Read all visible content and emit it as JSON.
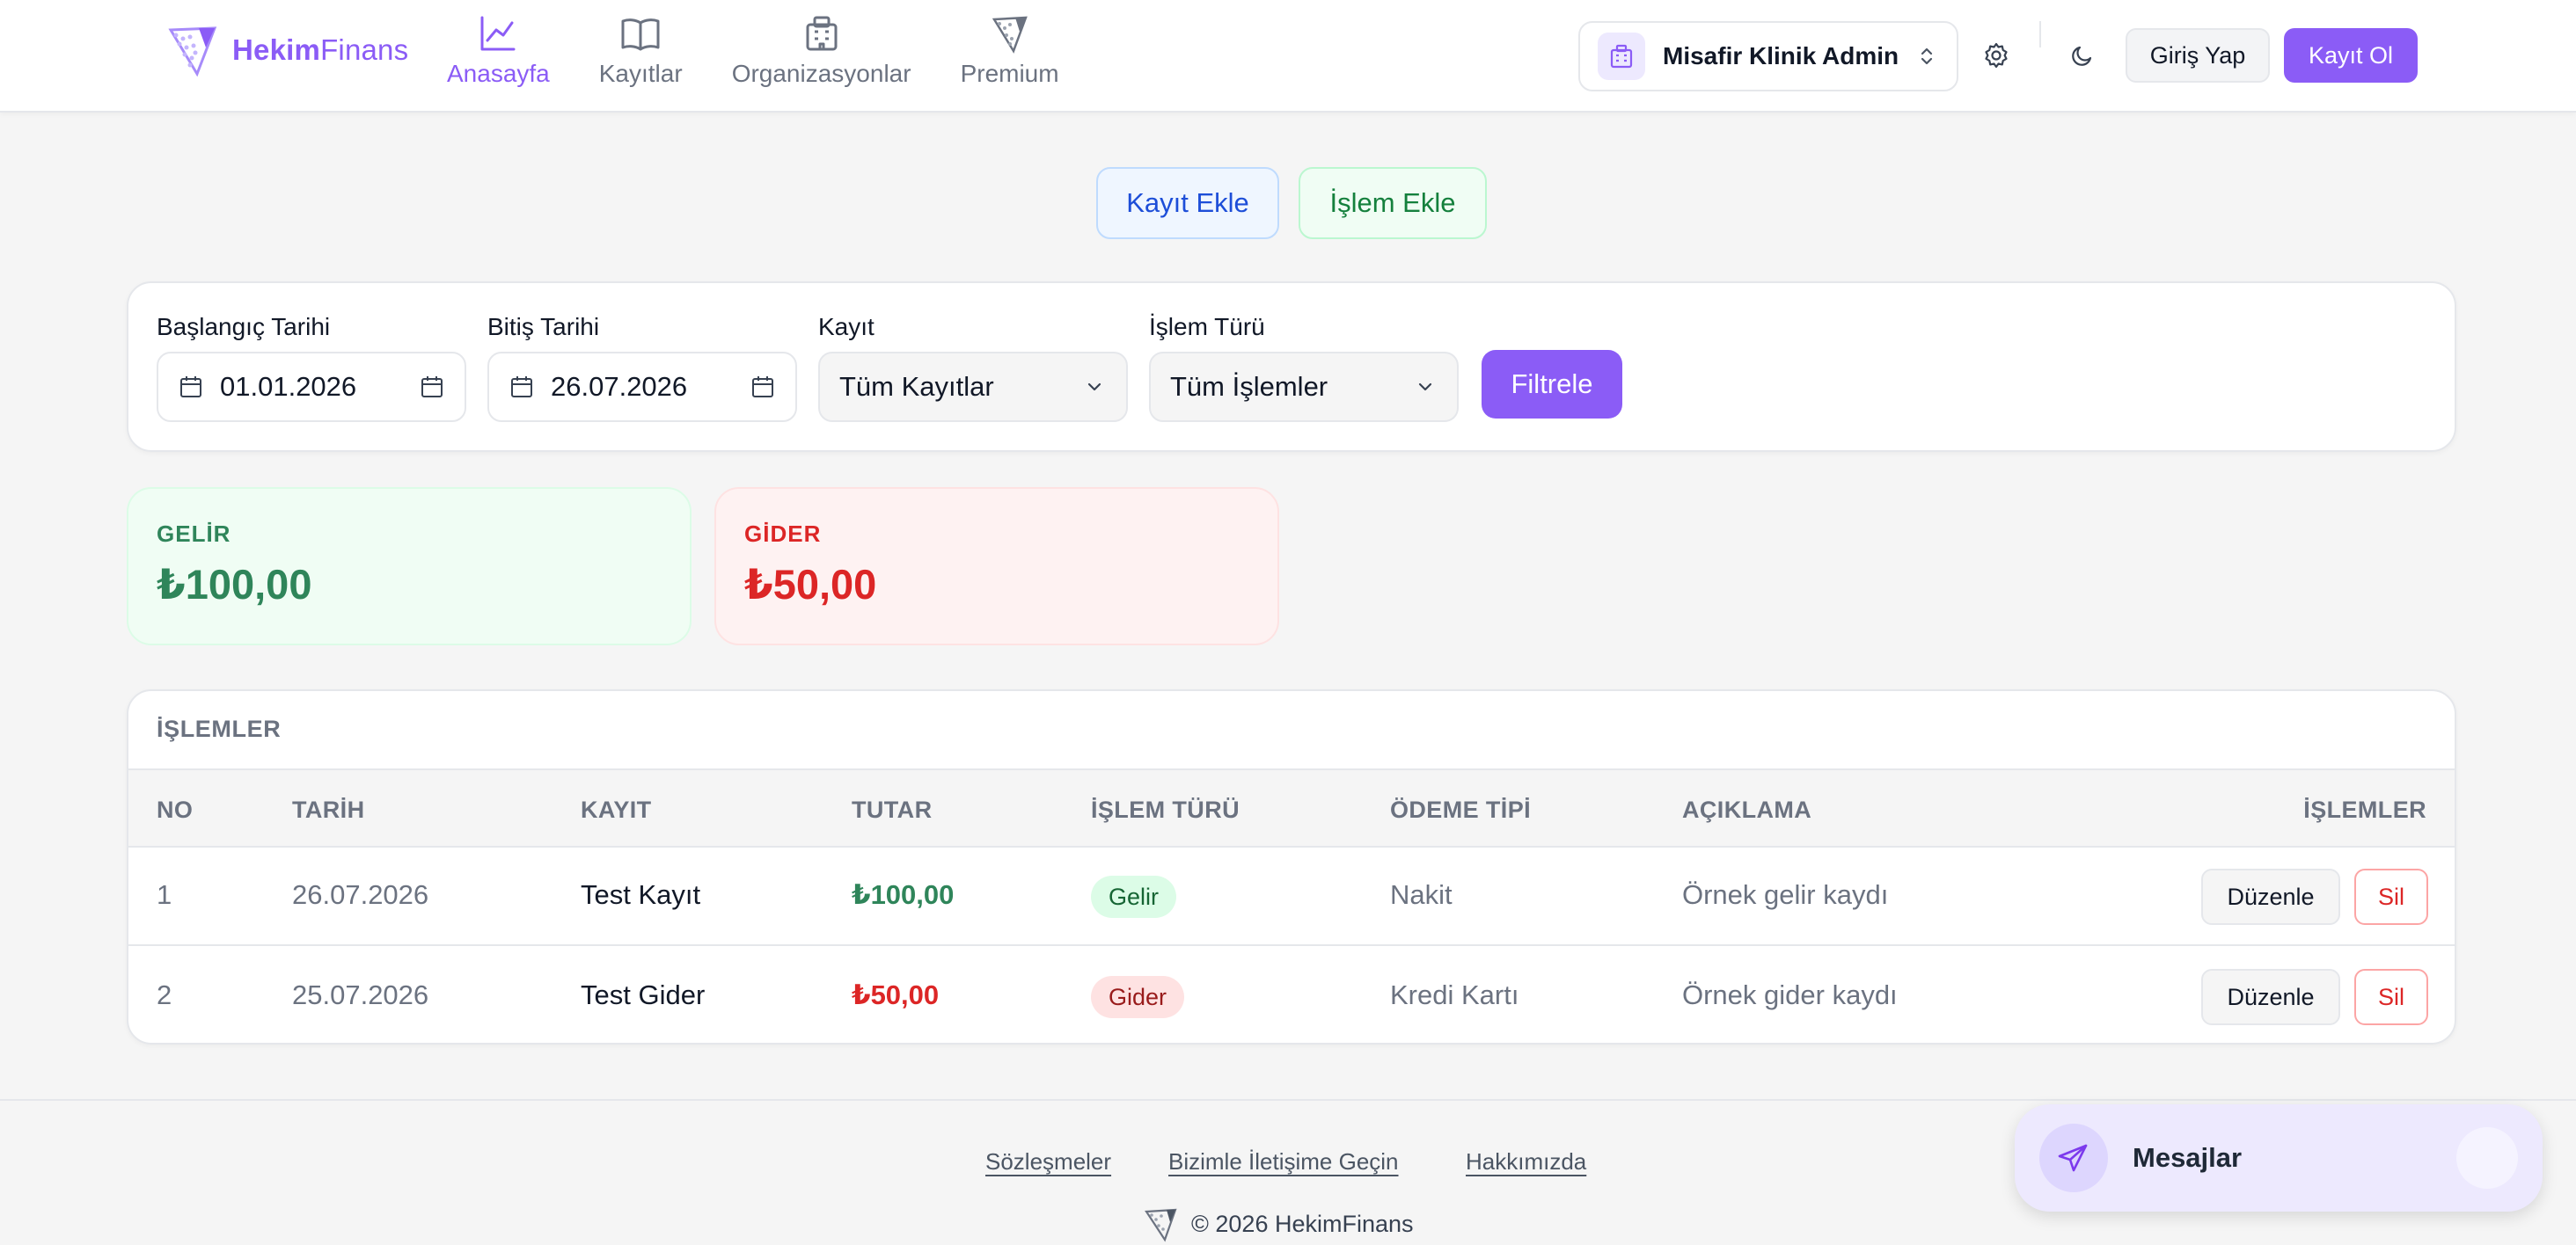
{
  "brand": {
    "name_bold": "Hekim",
    "name_light": "Finans"
  },
  "nav": [
    {
      "label": "Anasayfa",
      "icon": "chart-line-icon",
      "active": true
    },
    {
      "label": "Kayıtlar",
      "icon": "book-icon",
      "active": false
    },
    {
      "label": "Organizasyonlar",
      "icon": "building-icon",
      "active": false
    },
    {
      "label": "Premium",
      "icon": "logo-icon",
      "active": false
    }
  ],
  "header": {
    "organization": "Misafir Klinik Admin",
    "login_label": "Giriş Yap",
    "signup_label": "Kayıt Ol"
  },
  "actions": {
    "add_record": "Kayıt Ekle",
    "add_transaction": "İşlem Ekle"
  },
  "filters": {
    "start_label": "Başlangıç Tarihi",
    "start_value": "01.01.2026",
    "end_label": "Bitiş Tarihi",
    "end_value": "26.07.2026",
    "record_label": "Kayıt",
    "record_value": "Tüm Kayıtlar",
    "type_label": "İşlem Türü",
    "type_value": "Tüm İşlemler",
    "submit_label": "Filtrele"
  },
  "summary": {
    "income_label": "GELİR",
    "income_value": "₺100,00",
    "expense_label": "GİDER",
    "expense_value": "₺50,00"
  },
  "table": {
    "title": "İŞLEMLER",
    "headers": {
      "no": "NO",
      "date": "TARİH",
      "record": "KAYIT",
      "amount": "TUTAR",
      "type": "İŞLEM TÜRÜ",
      "payment": "ÖDEME TİPİ",
      "description": "AÇIKLAMA",
      "actions": "İŞLEMLER"
    },
    "rows": [
      {
        "no": "1",
        "date": "26.07.2026",
        "record": "Test Kayıt",
        "amount": "₺100,00",
        "type": "Gelir",
        "payment": "Nakit",
        "description": "Örnek gelir kaydı",
        "edit": "Düzenle",
        "delete": "Sil"
      },
      {
        "no": "2",
        "date": "25.07.2026",
        "record": "Test Gider",
        "amount": "₺50,00",
        "type": "Gider",
        "payment": "Kredi Kartı",
        "description": "Örnek gider kaydı",
        "edit": "Düzenle",
        "delete": "Sil"
      }
    ]
  },
  "footer": {
    "links": [
      "Sözleşmeler",
      "Bizimle İletişime Geçin",
      "Hakkımızda"
    ],
    "copyright": "© 2026 HekimFinans"
  },
  "messages": {
    "label": "Mesajlar"
  },
  "colors": {
    "accent": "#8b5cf6",
    "income": "#2f855a",
    "expense": "#dc2626"
  }
}
